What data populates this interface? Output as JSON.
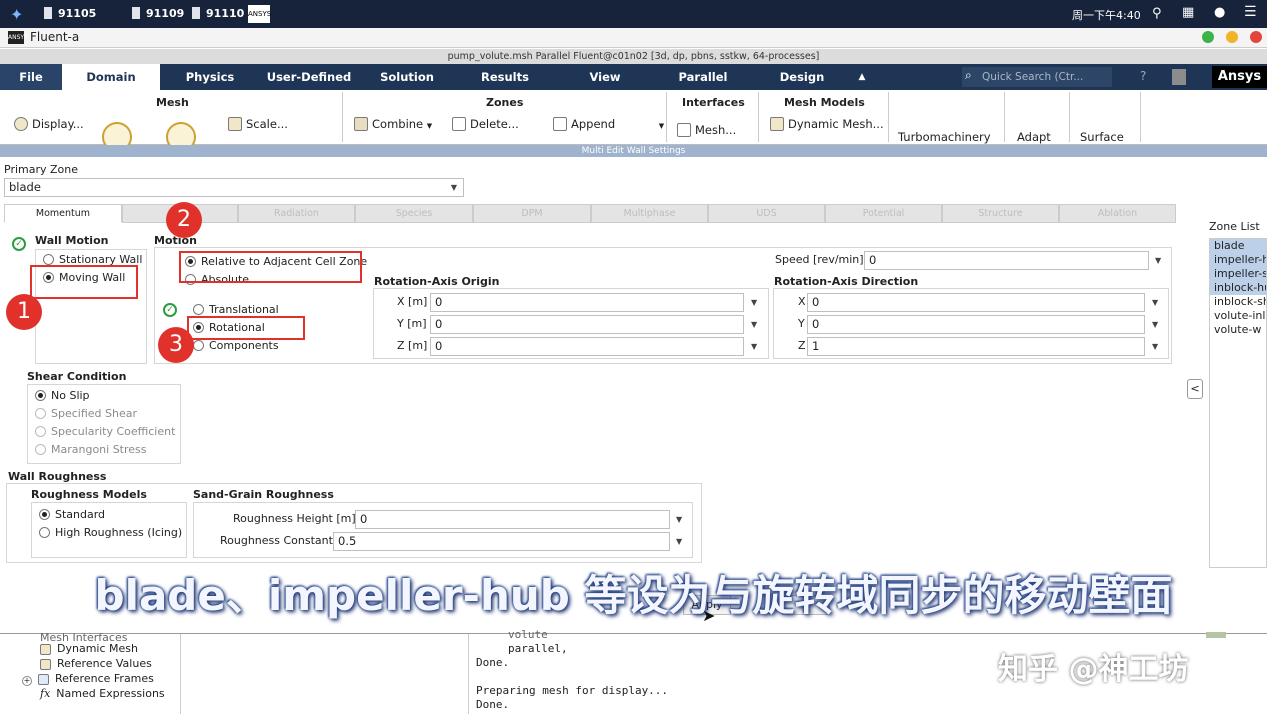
{
  "taskbar": {
    "items": [
      "91105",
      "91109",
      "91110"
    ],
    "clock": "周一下午4:40"
  },
  "app": {
    "title": "Fluent-a"
  },
  "window": {
    "title": "pump_volute.msh Parallel Fluent@c01n02  [3d, dp, pbns, sstkw, 64-processes]"
  },
  "ribbon_tabs": [
    "File",
    "Domain",
    "Physics",
    "User-Defined",
    "Solution",
    "Results",
    "View",
    "Parallel",
    "Design"
  ],
  "search": {
    "placeholder": "Quick Search (Ctr..."
  },
  "brand": "Ansys",
  "ribbon": {
    "mesh_group": "Mesh",
    "zones_group": "Zones",
    "interfaces_group": "Interfaces",
    "mesh_models_group": "Mesh Models",
    "display": "Display...",
    "scale": "Scale...",
    "combine": "Combine",
    "delete": "Delete...",
    "append": "Append",
    "mesh_interfaces": "Mesh...",
    "dynamic_mesh": "Dynamic Mesh...",
    "turbomachinery": "Turbomachinery",
    "adapt": "Adapt",
    "surface": "Surface"
  },
  "dialog": {
    "title": "Multi Edit Wall Settings",
    "primary_zone_label": "Primary Zone",
    "primary_zone_value": "blade",
    "tabs": [
      "Momentum",
      "",
      "Radiation",
      "Species",
      "DPM",
      "Multiphase",
      "UDS",
      "Potential",
      "Structure",
      "Ablation"
    ],
    "wall_motion": {
      "title": "Wall Motion",
      "options": [
        "Stationary Wall",
        "Moving Wall"
      ],
      "selected": "Moving Wall"
    },
    "motion": {
      "title": "Motion",
      "reference": [
        "Relative to Adjacent Cell Zone",
        "Absolute"
      ],
      "type": [
        "Translational",
        "Rotational",
        "Components"
      ],
      "selected_type": "Rotational"
    },
    "speed": {
      "label": "Speed [rev/min]",
      "value": "0"
    },
    "origin": {
      "title": "Rotation-Axis Origin",
      "x_label": "X [m]",
      "x": "0",
      "y_label": "Y [m]",
      "y": "0",
      "z_label": "Z [m]",
      "z": "0"
    },
    "direction": {
      "title": "Rotation-Axis Direction",
      "x_label": "X",
      "x": "0",
      "y_label": "Y",
      "y": "0",
      "z_label": "Z",
      "z": "1"
    },
    "shear": {
      "title": "Shear Condition",
      "options": [
        "No Slip",
        "Specified Shear",
        "Specularity Coefficient",
        "Marangoni Stress"
      ]
    },
    "wall_roughness": {
      "title": "Wall Roughness",
      "models_title": "Roughness Models",
      "models": [
        "Standard",
        "High Roughness (Icing)"
      ],
      "sand_title": "Sand-Grain Roughness",
      "height_label": "Roughness Height [m]",
      "height": "0",
      "constant_label": "Roughness Constant",
      "constant": "0.5"
    },
    "zone_list": {
      "title": "Zone List",
      "items": [
        "blade",
        "impeller-h",
        "impeller-s",
        "inblock-hu",
        "inblock-sh",
        "volute-inle",
        "volute-w"
      ],
      "selected": [
        0,
        1,
        2,
        3
      ]
    },
    "apply": "Apply"
  },
  "tree": [
    "Mesh Interfaces",
    "Dynamic Mesh",
    "Reference Values",
    "Reference Frames",
    "Named Expressions"
  ],
  "console": [
    "volute",
    "parallel,",
    "Done.",
    "",
    "Preparing mesh for display...",
    "Done."
  ],
  "annotations": {
    "badges": [
      "1",
      "2",
      "3"
    ]
  },
  "subtitle": "blade、impeller-hub 等设为与旋转域同步的移动壁面",
  "watermark": "知乎 @神工坊",
  "colors": {
    "ribbon": "#1f3556",
    "highlight": "#e0322b",
    "selection": "#bcd0ea"
  }
}
